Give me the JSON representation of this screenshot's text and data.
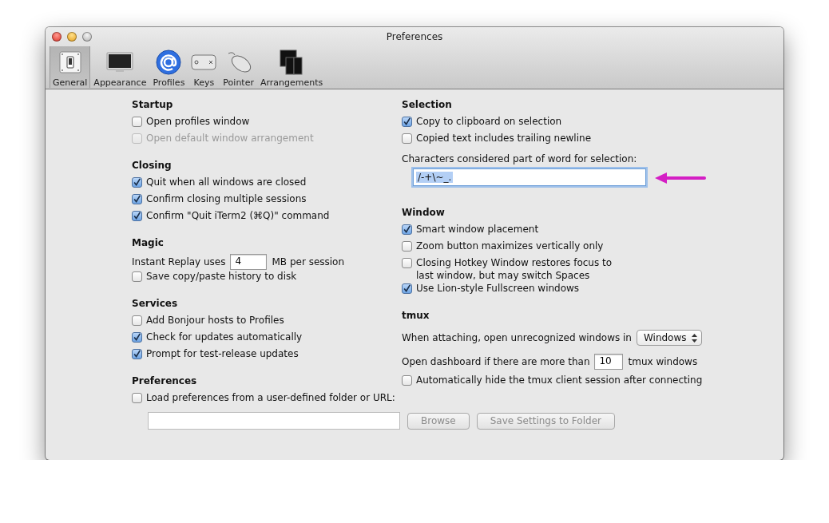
{
  "window": {
    "title": "Preferences"
  },
  "toolbar": [
    {
      "label": "General",
      "selected": true,
      "kind": "switch"
    },
    {
      "label": "Appearance",
      "selected": false,
      "kind": "monitor"
    },
    {
      "label": "Profiles",
      "selected": false,
      "kind": "at"
    },
    {
      "label": "Keys",
      "selected": false,
      "kind": "keyboard"
    },
    {
      "label": "Pointer",
      "selected": false,
      "kind": "mouse"
    },
    {
      "label": "Arrangements",
      "selected": false,
      "kind": "windows"
    }
  ],
  "left_column": [
    {
      "heading": "Startup",
      "items": [
        {
          "kind": "checkbox",
          "label": "Open profiles window",
          "checked": false,
          "disabled": false
        },
        {
          "kind": "checkbox",
          "label": "Open default window arrangement",
          "checked": false,
          "disabled": true
        }
      ]
    },
    {
      "heading": "Closing",
      "items": [
        {
          "kind": "checkbox",
          "label": "Quit when all windows are closed",
          "checked": true,
          "disabled": false
        },
        {
          "kind": "checkbox",
          "label": "Confirm closing multiple sessions",
          "checked": true,
          "disabled": false
        },
        {
          "kind": "checkbox",
          "label": "Confirm \"Quit iTerm2 (⌘Q)\" command",
          "checked": true,
          "disabled": false
        }
      ]
    },
    {
      "heading": "Magic",
      "items": [
        {
          "kind": "number_row",
          "before": "Instant Replay uses",
          "value": "4",
          "after": "MB per session"
        },
        {
          "kind": "checkbox",
          "label": "Save copy/paste history to disk",
          "checked": false,
          "disabled": false
        }
      ]
    },
    {
      "heading": "Services",
      "items": [
        {
          "kind": "checkbox",
          "label": "Add Bonjour hosts to Profiles",
          "checked": false,
          "disabled": false
        },
        {
          "kind": "checkbox",
          "label": "Check for updates automatically",
          "checked": true,
          "disabled": false
        },
        {
          "kind": "checkbox",
          "label": "Prompt for test-release updates",
          "checked": true,
          "disabled": false
        }
      ]
    },
    {
      "heading": "Preferences",
      "items": [
        {
          "kind": "checkbox",
          "label": "Load preferences from a user-defined folder or URL:",
          "checked": false,
          "disabled": false
        },
        {
          "kind": "path_row",
          "buttons": [
            {
              "label": "Browse",
              "disabled": true
            },
            {
              "label": "Save Settings to Folder",
              "disabled": true
            }
          ]
        }
      ]
    }
  ],
  "right_column": [
    {
      "heading": "Selection",
      "items": [
        {
          "kind": "checkbox",
          "label": "Copy to clipboard on selection",
          "checked": true,
          "disabled": false
        },
        {
          "kind": "checkbox",
          "label": "Copied text includes trailing newline",
          "checked": false,
          "disabled": false
        },
        {
          "kind": "label",
          "text": "Characters considered part of word for selection:"
        },
        {
          "kind": "text_field",
          "value": "/-+\\~_.",
          "selected": true
        }
      ]
    },
    {
      "heading": "Window",
      "items": [
        {
          "kind": "checkbox",
          "label": "Smart window placement",
          "checked": true,
          "disabled": false
        },
        {
          "kind": "checkbox",
          "label": "Zoom button maximizes vertically only",
          "checked": false,
          "disabled": false
        },
        {
          "kind": "checkbox",
          "label": "Closing Hotkey Window restores focus to\nlast window, but may switch Spaces",
          "checked": false,
          "disabled": false
        },
        {
          "kind": "checkbox",
          "label": "Use Lion-style Fullscreen windows",
          "checked": true,
          "disabled": false
        }
      ]
    },
    {
      "heading": "tmux",
      "items": [
        {
          "kind": "popup_row",
          "before": "When attaching, open unrecognized windows in",
          "value": "Windows"
        },
        {
          "kind": "number_row",
          "before": "Open dashboard if there are more than",
          "value": "10",
          "after": "tmux windows"
        },
        {
          "kind": "checkbox",
          "label": "Automatically hide the tmux client session after connecting",
          "checked": false,
          "disabled": false
        }
      ]
    }
  ]
}
